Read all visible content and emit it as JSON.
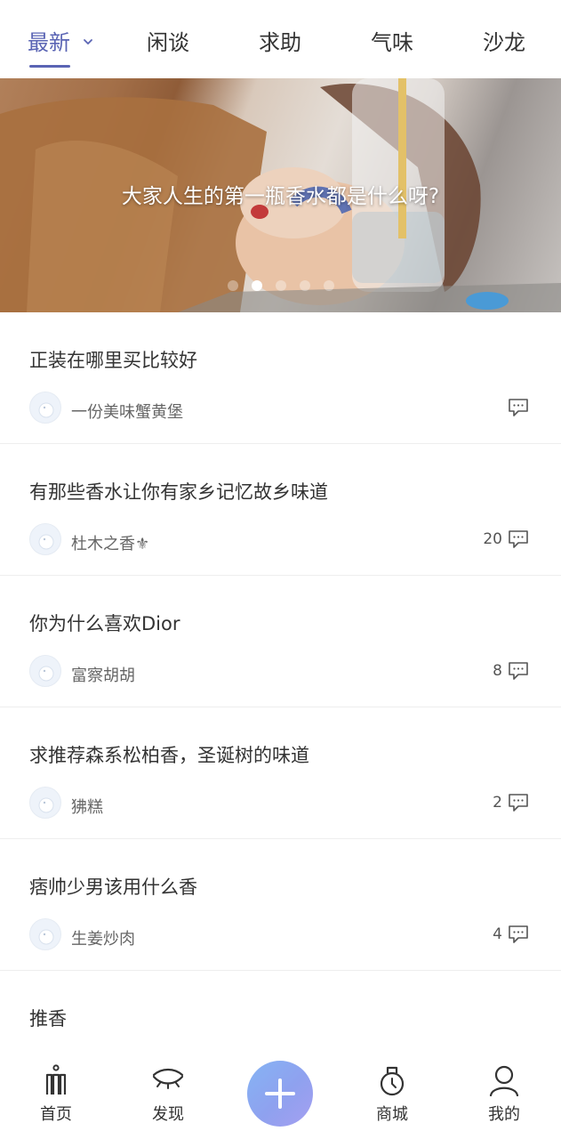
{
  "tabs": [
    {
      "label": "最新",
      "active": true
    },
    {
      "label": "闲谈"
    },
    {
      "label": "求助"
    },
    {
      "label": "气味"
    },
    {
      "label": "沙龙"
    }
  ],
  "banner": {
    "caption": "大家人生的第一瓶香水都是什么呀?",
    "slide_count": 5,
    "active_slide": 2
  },
  "posts": [
    {
      "title": "正装在哪里买比较好",
      "author": "一份美味蟹黄堡",
      "comments": ""
    },
    {
      "title": "有那些香水让你有家乡记忆故乡味道",
      "author": "杜木之香⚜",
      "comments": "20"
    },
    {
      "title": "你为什么喜欢Dior",
      "author": "富察胡胡",
      "comments": "8"
    },
    {
      "title": "求推荐森系松柏香，圣诞树的味道",
      "author": "狒糕",
      "comments": "2"
    },
    {
      "title": "痞帅少男该用什么香",
      "author": "生姜炒肉",
      "comments": "4"
    },
    {
      "title": "推香",
      "author": "",
      "comments": ""
    }
  ],
  "bottom_nav": {
    "home": "首页",
    "discover": "发现",
    "shop": "商城",
    "mine": "我的"
  },
  "colors": {
    "accent": "#5a64b4",
    "fab_gradient_start": "#85b4f4",
    "fab_gradient_end": "#a59ff0"
  }
}
